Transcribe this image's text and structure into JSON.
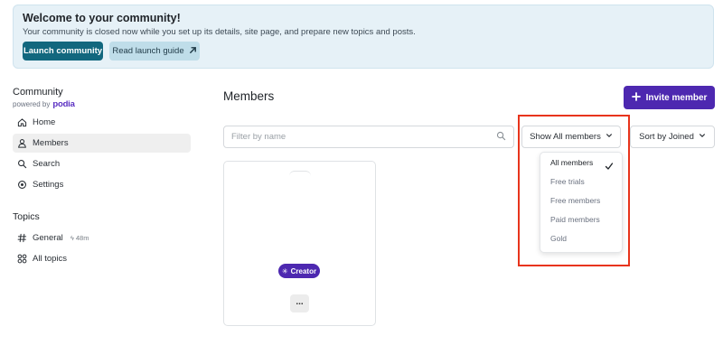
{
  "banner": {
    "title": "Welcome to your community!",
    "text": "Your community is closed now while you set up its details, site page, and prepare new topics and posts.",
    "launch_label": "Launch community",
    "guide_label": "Read launch guide",
    "guide_icon": "arrow-up-right-icon"
  },
  "sidebar": {
    "title": "Community",
    "powered_by": "powered by",
    "logo_text": "podia",
    "items": [
      {
        "label": "Home",
        "icon": "home-icon"
      },
      {
        "label": "Members",
        "icon": "user-icon",
        "active": true
      },
      {
        "label": "Search",
        "icon": "search-icon"
      },
      {
        "label": "Settings",
        "icon": "settings-icon"
      }
    ],
    "topics_label": "Topics",
    "topics": [
      {
        "label": "General",
        "icon": "hash-icon",
        "time": "48m"
      },
      {
        "label": "All topics",
        "icon": "grid-icon"
      }
    ]
  },
  "main": {
    "title": "Members",
    "invite_label": "Invite member",
    "filter_placeholder": "Filter by name",
    "show_label": "Show All members",
    "sort_label": "Sort by Joined",
    "dropdown": {
      "options": [
        "All members",
        "Free trials",
        "Free members",
        "Paid members",
        "Gold"
      ],
      "selected": "All members"
    },
    "card": {
      "badge_label": "Creator",
      "more_label": "..."
    }
  },
  "colors": {
    "accent_purple": "#4d28b0",
    "launch_teal": "#12677e",
    "highlight_red": "#e8341c",
    "banner_bg": "#e6f1f7"
  }
}
